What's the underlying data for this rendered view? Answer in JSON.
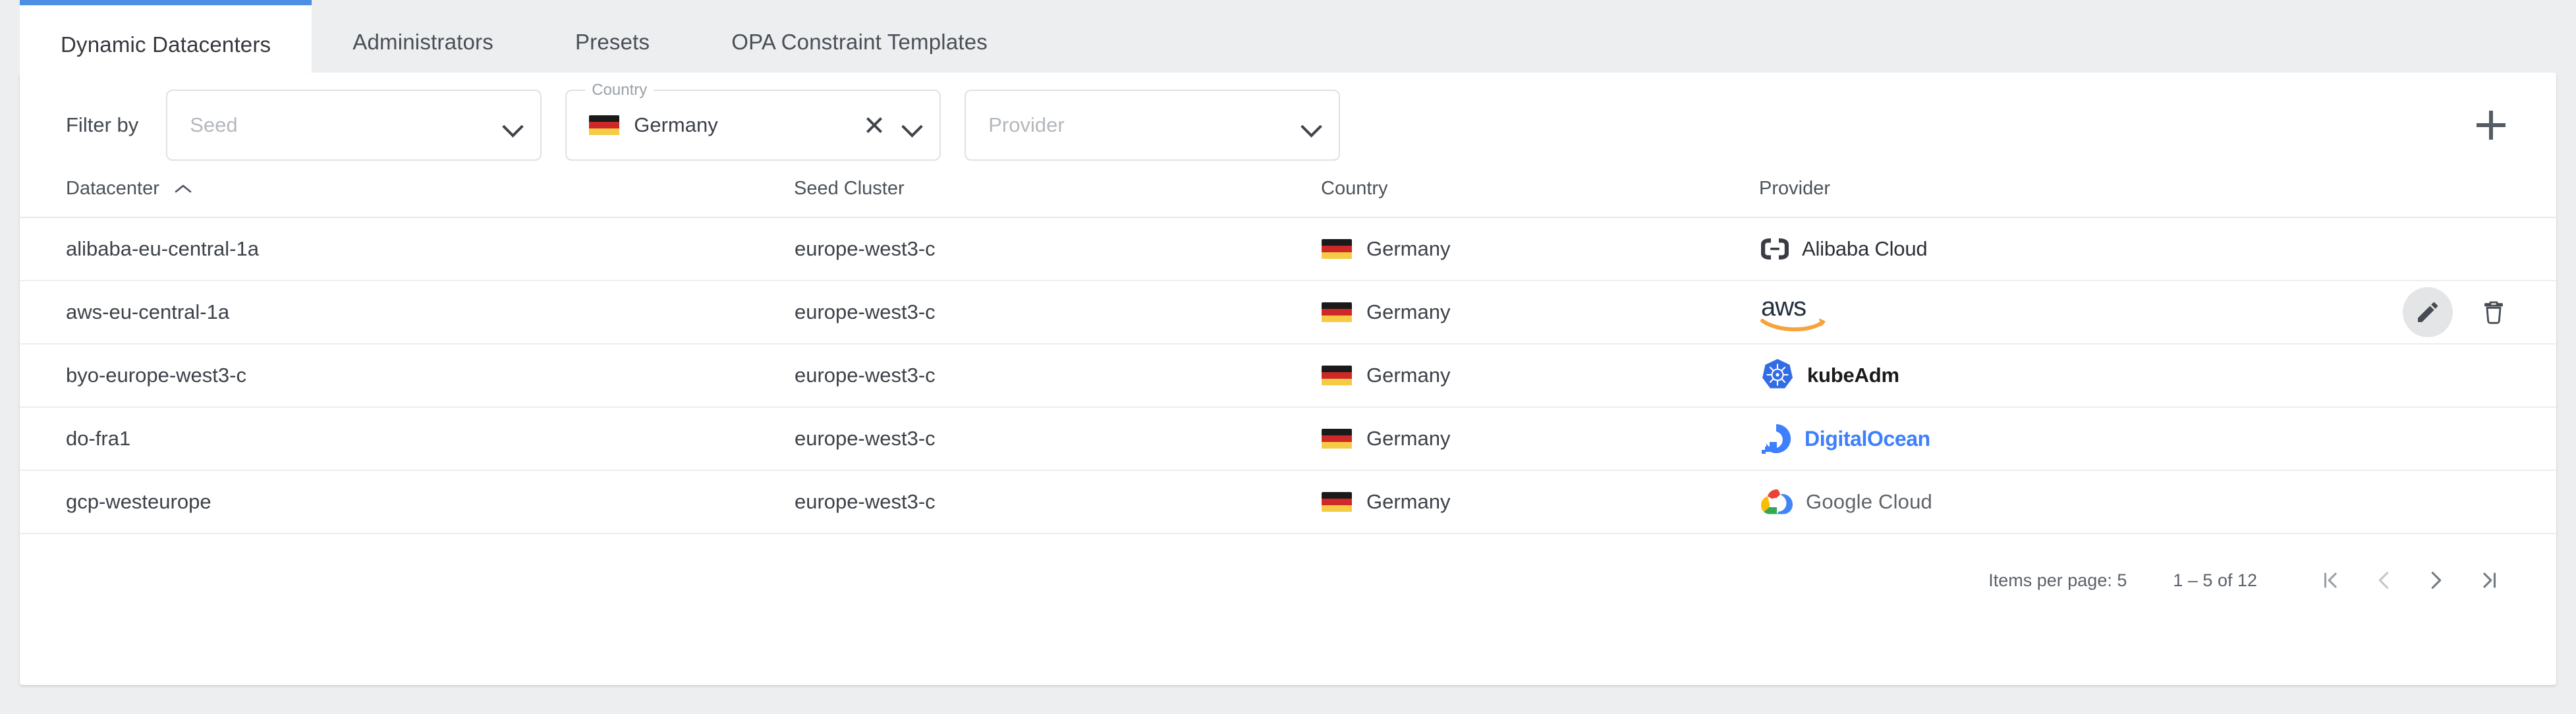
{
  "tabs": [
    {
      "label": "Dynamic Datacenters",
      "active": true
    },
    {
      "label": "Administrators",
      "active": false
    },
    {
      "label": "Presets",
      "active": false
    },
    {
      "label": "OPA Constraint Templates",
      "active": false
    }
  ],
  "filter": {
    "label": "Filter by",
    "seed": {
      "placeholder": "Seed",
      "value": "",
      "icon": "chevron-down-icon"
    },
    "country": {
      "floating_label": "Country",
      "value": "Germany",
      "flag": "de-flag-icon",
      "clear_icon": "close-icon",
      "icon": "chevron-down-icon"
    },
    "provider": {
      "placeholder": "Provider",
      "value": "",
      "icon": "chevron-down-icon"
    },
    "add_button": "+"
  },
  "table": {
    "columns": [
      {
        "key": "datacenter",
        "label": "Datacenter",
        "sort": "asc",
        "sort_glyph": "˄"
      },
      {
        "key": "seed",
        "label": "Seed Cluster"
      },
      {
        "key": "country",
        "label": "Country"
      },
      {
        "key": "provider",
        "label": "Provider"
      }
    ],
    "rows": [
      {
        "datacenter": "alibaba-eu-central-1a",
        "seed": "europe-west3-c",
        "country": "Germany",
        "provider": "Alibaba Cloud",
        "provider_logo": "alibaba-cloud-logo",
        "hovered": false
      },
      {
        "datacenter": "aws-eu-central-1a",
        "seed": "europe-west3-c",
        "country": "Germany",
        "provider": "aws",
        "provider_logo": "aws-logo",
        "hovered": true
      },
      {
        "datacenter": "byo-europe-west3-c",
        "seed": "europe-west3-c",
        "country": "Germany",
        "provider": "kubeAdm",
        "provider_logo": "kubernetes-logo",
        "hovered": false
      },
      {
        "datacenter": "do-fra1",
        "seed": "europe-west3-c",
        "country": "Germany",
        "provider": "DigitalOcean",
        "provider_logo": "digitalocean-logo",
        "hovered": false
      },
      {
        "datacenter": "gcp-westeurope",
        "seed": "europe-west3-c",
        "country": "Germany",
        "provider": "Google Cloud",
        "provider_logo": "google-cloud-logo",
        "hovered": false
      }
    ],
    "row_actions": {
      "edit": "edit-icon",
      "delete": "delete-icon"
    }
  },
  "paginator": {
    "items_per_page_label": "Items per page:",
    "items_per_page_value": "5",
    "range_label": "1 – 5 of 12",
    "first_icon": "first-page-icon",
    "prev_icon": "previous-page-icon",
    "next_icon": "next-page-icon",
    "last_icon": "last-page-icon"
  },
  "colors": {
    "accent": "#4d90e3",
    "tabbar_bg": "#eceef0",
    "card_bg": "#ffffff",
    "text": "#3c4149",
    "muted": "#b4b8bd",
    "digitalocean": "#3d7ffc",
    "kubernetes": "#326ce5",
    "aws_orange": "#f7a33c",
    "google_red": "#ea4335",
    "google_yellow": "#fbbc05",
    "google_green": "#34a853",
    "google_blue": "#4285f4"
  }
}
